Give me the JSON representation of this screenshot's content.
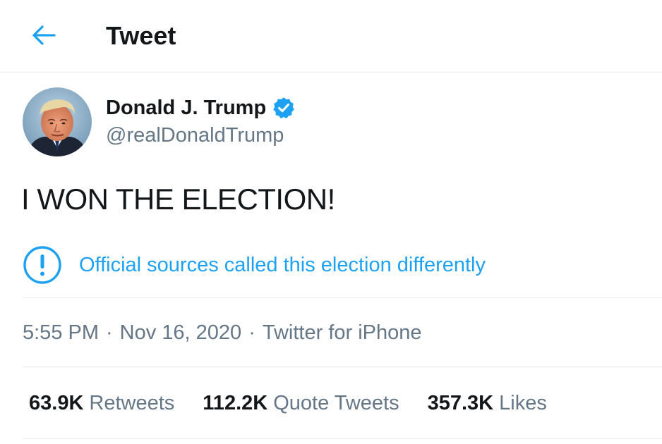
{
  "header": {
    "back_icon": "arrow-left-icon",
    "title": "Tweet"
  },
  "colors": {
    "accent": "#1da1f2",
    "text_primary": "#14171a",
    "text_secondary": "#657786",
    "divider": "#e6ecf0"
  },
  "tweet": {
    "author": {
      "name": "Donald J. Trump",
      "handle": "@realDonaldTrump",
      "verified": true,
      "verified_icon": "verified-badge-icon",
      "avatar_icon": "avatar"
    },
    "text": "I WON THE ELECTION!",
    "notice": {
      "icon": "exclamation-circle-icon",
      "text": "Official sources called this election differently"
    },
    "meta": {
      "time": "5:55 PM",
      "separator": "·",
      "date": "Nov 16, 2020",
      "source": "Twitter for iPhone"
    },
    "stats": [
      {
        "count": "63.9K",
        "label": "Retweets"
      },
      {
        "count": "112.2K",
        "label": "Quote Tweets"
      },
      {
        "count": "357.3K",
        "label": "Likes"
      }
    ]
  }
}
